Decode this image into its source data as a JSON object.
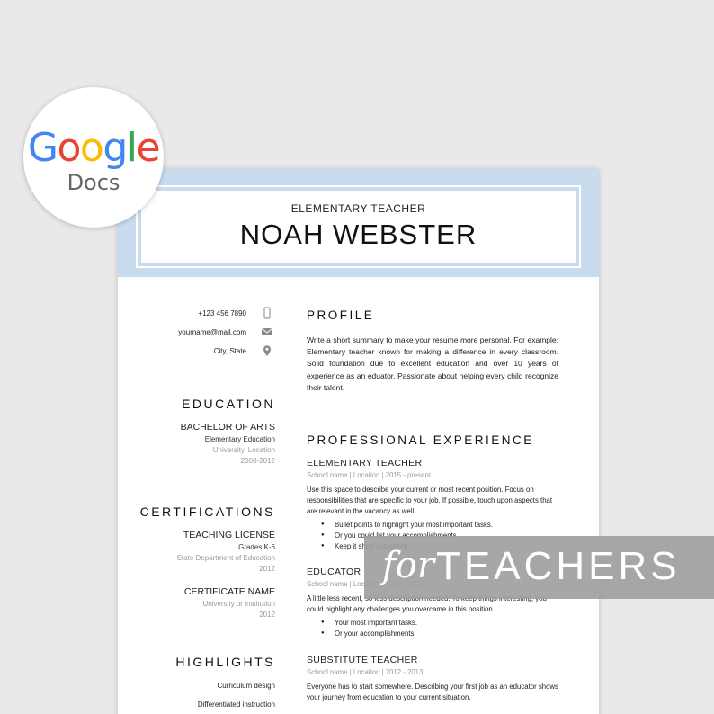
{
  "badge": {
    "google_letters": [
      {
        "ch": "G",
        "color": "#4285F4"
      },
      {
        "ch": "o",
        "color": "#EA4335"
      },
      {
        "ch": "o",
        "color": "#FBBC05"
      },
      {
        "ch": "g",
        "color": "#4285F4"
      },
      {
        "ch": "l",
        "color": "#34A853"
      },
      {
        "ch": "e",
        "color": "#EA4335"
      }
    ],
    "docs": "Docs"
  },
  "banner": {
    "for": "for",
    "teachers": "TEACHERS"
  },
  "resume": {
    "header": {
      "job_title": "ELEMENTARY TEACHER",
      "name": "NOAH WEBSTER",
      "band_color": "#c9dbee"
    },
    "contact": [
      {
        "text": "+123 456 7890",
        "icon": "phone-icon"
      },
      {
        "text": "yourname@mail.com",
        "icon": "mail-icon"
      },
      {
        "text": "City, State",
        "icon": "location-icon"
      }
    ],
    "education": {
      "title": "EDUCATION",
      "degree": "BACHELOR OF ARTS",
      "field": "Elementary Education",
      "school": "University, Location",
      "years": "2008-2012"
    },
    "certifications": {
      "title": "CERTIFICATIONS",
      "items": [
        {
          "name": "TEACHING LICENSE",
          "sub": "Grades K-6",
          "issuer": "State Department of Education",
          "year": "2012"
        },
        {
          "name": "CERTIFICATE NAME",
          "sub": "",
          "issuer": "University or institution",
          "year": "2012"
        }
      ]
    },
    "highlights": {
      "title": "HIGHLIGHTS",
      "items": [
        "Curriculum design",
        "Differentiated instruction"
      ]
    },
    "profile": {
      "title": "PROFILE",
      "text": "Write a short summary to make your resume more personal. For example: Elementary teacher known for making a difference in every classroom. Solid foundation due to excellent education and over 10 years of experience as an eduator. Passionate about helping every child recognize their talent."
    },
    "experience": {
      "title": "PROFESSIONAL EXPERIENCE",
      "jobs": [
        {
          "title": "ELEMENTARY TEACHER",
          "meta": "School name | Location | 2015 - present",
          "desc": "Use this space to describe your current or most recent position. Focus on responsibilities that are specific to your job. If possible, touch upon aspects that are relevant in the vacancy as well.",
          "bullets": [
            "Bullet points to highlight your most important tasks.",
            "Or you could list your accomplishments.",
            "Keep it short and sweet."
          ]
        },
        {
          "title": "EDUCATOR",
          "meta": "School name | Location | 2013 - 2015",
          "desc": "A little less recent, so less description needed. To keep things interesting, you could highlight any challenges you overcame in this position.",
          "bullets": [
            "Your most important tasks.",
            "Or your accomplishments."
          ]
        },
        {
          "title": "SUBSTITUTE TEACHER",
          "meta": "School name | Location | 2012 - 2013",
          "desc": "Everyone has to start somewhere. Describing your first job as an educator shows your journey from education to your current situation.",
          "bullets": []
        }
      ]
    }
  }
}
